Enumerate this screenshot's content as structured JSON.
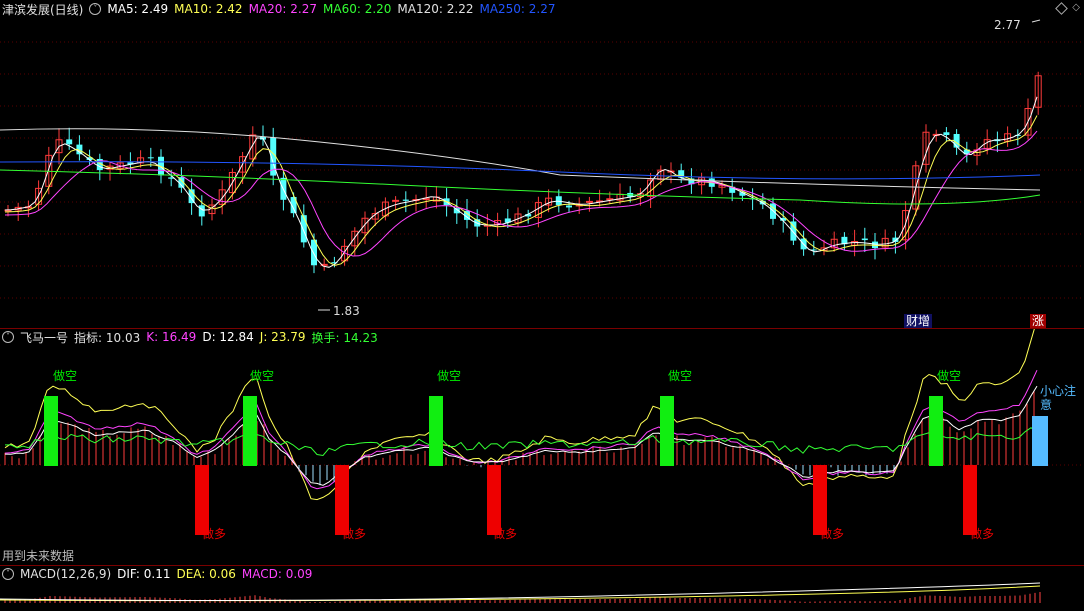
{
  "main": {
    "title": "津滨发展(日线)",
    "toggle_icon": "chevron-down-icon",
    "ma": [
      {
        "label": "MA5: 2.49",
        "color": "#ffffff"
      },
      {
        "label": "MA10: 2.42",
        "color": "#ffff55"
      },
      {
        "label": "MA20: 2.27",
        "color": "#ff44ff"
      },
      {
        "label": "MA60: 2.20",
        "color": "#33ff33"
      },
      {
        "label": "MA120: 2.22",
        "color": "#e0e0e0"
      },
      {
        "label": "MA250: 2.27",
        "color": "#2255ff"
      }
    ],
    "high_label": "2.77",
    "low_label": "1.83",
    "badge_caizeng": "财增",
    "badge_zhang": "涨"
  },
  "indicator": {
    "name": "飞马一号",
    "zhibiao": "指标: 10.03",
    "k": "K: 16.49",
    "d": "D: 12.84",
    "j": "J: 23.79",
    "huanshou": "换手: 14.23",
    "zuokong": "做空",
    "zuoduo": "做多",
    "xiaoxin": "小心注意",
    "future_note": "用到未来数据",
    "colors": {
      "k": "#ff44ff",
      "d": "#ffffff",
      "j": "#ffff55",
      "huanshou": "#33ff33",
      "sell": "#00ee00",
      "buy": "#ee0000",
      "warn": "#55bbff"
    }
  },
  "macd": {
    "name": "MACD(12,26,9)",
    "dif": "DIF: 0.11",
    "dea": "DEA: 0.06",
    "macd": "MACD: 0.09",
    "colors": {
      "dif": "#ffffff",
      "dea": "#ffff55",
      "macd": "#ff44ff"
    }
  }
}
